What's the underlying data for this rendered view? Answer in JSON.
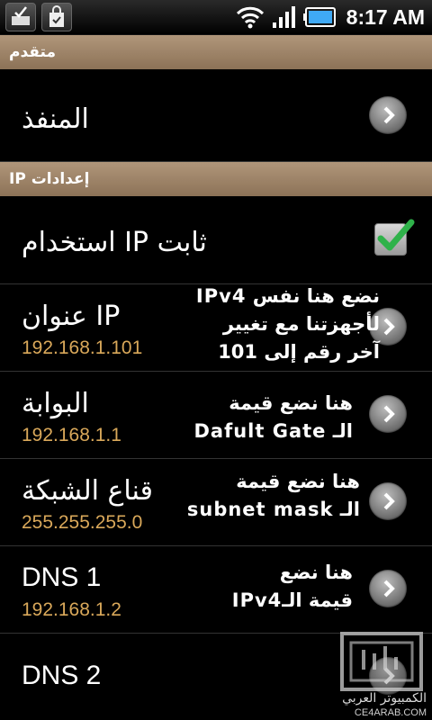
{
  "status_bar": {
    "time": "8:17 AM",
    "icons": [
      "usb-debug-icon",
      "market-bag-icon",
      "wifi-icon",
      "signal-icon",
      "battery-icon"
    ]
  },
  "sections": {
    "advanced_header": "متقدم",
    "ip_settings_header": "إعدادات IP"
  },
  "items": {
    "proxy": {
      "title": "المنفذ"
    },
    "static_ip": {
      "title": "استخدام IP ثابت",
      "checked": true
    },
    "ip_address": {
      "title": "عنوان IP",
      "value": "192.168.1.101"
    },
    "gateway": {
      "title": "البوابة",
      "value": "192.168.1.1"
    },
    "netmask": {
      "title": "قناع الشبكة",
      "value": "255.255.255.0"
    },
    "dns1": {
      "title": "DNS 1",
      "value": "192.168.1.2"
    },
    "dns2": {
      "title": "DNS 2"
    }
  },
  "annotations": {
    "ip_note": [
      "نضع هنا نفس IPv4",
      "لأجهزتنا مع تغيير",
      "آخر رقم إلى 101"
    ],
    "gateway_note": [
      "هنا نضع قيمة",
      "الـ Dafult Gate"
    ],
    "netmask_note": [
      "هنا نضع قيمة",
      "الـ subnet mask"
    ],
    "dns_note": [
      "هنا نضع",
      "قيمة الـIPv4"
    ]
  },
  "watermark": {
    "name": "الكمبيوتر العربي",
    "url": "CE4ARAB.COM"
  },
  "colors": {
    "section_header": "#9c8266",
    "value_text": "#d9a85a",
    "check_green": "#2fb24a",
    "battery_blue": "#3fa9f5"
  }
}
